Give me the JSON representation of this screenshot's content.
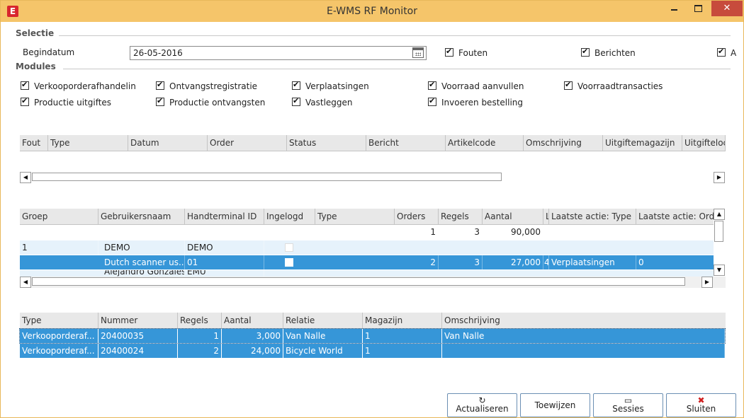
{
  "window": {
    "title": "E-WMS RF Monitor",
    "app_icon": "E",
    "close_glyph": "✕"
  },
  "selectie": {
    "label": "Selectie",
    "begindatum_label": "Begindatum",
    "begindatum_value": "26-05-2016",
    "checks": [
      {
        "label": "Fouten",
        "checked": true
      },
      {
        "label": "Berichten",
        "checked": true
      },
      {
        "label": "A",
        "checked": true
      }
    ]
  },
  "modules": {
    "label": "Modules",
    "items": [
      "Verkooporderafhandelin",
      "Ontvangstregistratie",
      "Verplaatsingen",
      "Voorraad aanvullen",
      "Voorraadtransacties",
      "Productie uitgiftes",
      "Productie ontvangsten",
      "Vastleggen",
      "Invoeren bestelling"
    ]
  },
  "messages_grid": {
    "columns": [
      "Fout",
      "Type",
      "Datum",
      "Order",
      "Status",
      "Bericht",
      "Artikelcode",
      "Omschrijving",
      "Uitgiftemagazijn",
      "Uitgifteloc"
    ]
  },
  "sessions_grid": {
    "columns": [
      "Groep",
      "Gebruikersnaam",
      "Handterminal ID",
      "Ingelogd",
      "Type",
      "Orders",
      "Regels",
      "Aantal",
      "L",
      "Laatste actie: Type",
      "Laatste actie: Orde"
    ],
    "totals": {
      "orders": "1",
      "regels": "3",
      "aantal": "90,000"
    },
    "rows": [
      {
        "groep": "1",
        "gebruiker": "DEMO",
        "terminal": "DEMO",
        "orders": "",
        "regels": "",
        "aantal": "",
        "l": "",
        "laatste_type": "",
        "laatste_order": ""
      },
      {
        "groep": "",
        "gebruiker": "Dutch scanner us...",
        "terminal": "01",
        "orders": "2",
        "regels": "3",
        "aantal": "27,000",
        "l": "4",
        "laatste_type": "Verplaatsingen",
        "laatste_order": "0"
      },
      {
        "groep": "",
        "gebruiker": "Alejandro Gonzales",
        "terminal": "EMU",
        "orders": "",
        "regels": "",
        "aantal": "",
        "l": "",
        "laatste_type": "",
        "laatste_order": ""
      }
    ]
  },
  "orders_grid": {
    "columns": [
      "Type",
      "Nummer",
      "Regels",
      "Aantal",
      "Relatie",
      "Magazijn",
      "Omschrijving"
    ],
    "rows": [
      {
        "type": "Verkooporderaf...",
        "nummer": "20400035",
        "regels": "1",
        "aantal": "3,000",
        "relatie": "Van Nalle",
        "magazijn": "1",
        "omschrijving": "Van Nalle"
      },
      {
        "type": "Verkooporderaf...",
        "nummer": "20400024",
        "regels": "2",
        "aantal": "24,000",
        "relatie": "Bicycle World",
        "magazijn": "1",
        "omschrijving": ""
      }
    ]
  },
  "buttons": {
    "actualiseren": "Actualiseren",
    "toewijzen": "Toewijzen",
    "sessies": "Sessies",
    "sluiten": "Sluiten",
    "refresh_icon": "↻",
    "folder_icon": "▭",
    "close_icon": "✖"
  },
  "colors": {
    "titlebar": "#f5c56a",
    "selection": "#3696d8",
    "close": "#c74b3c"
  }
}
